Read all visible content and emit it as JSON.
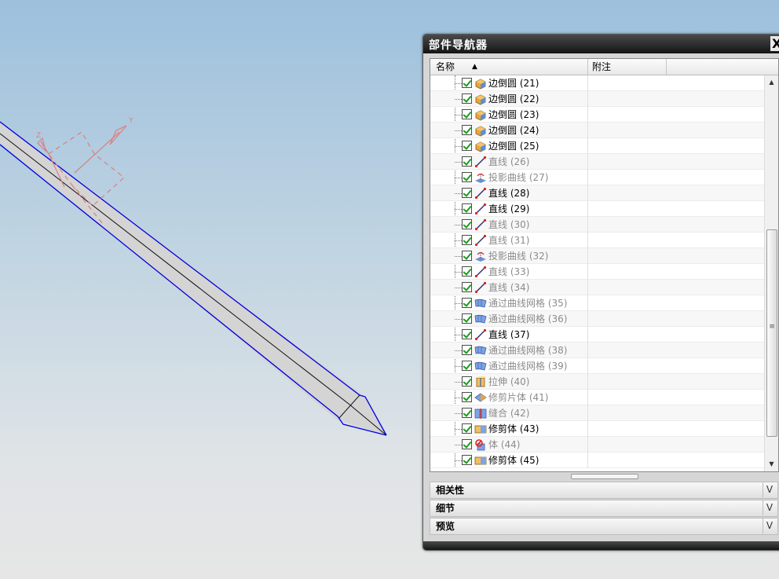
{
  "navigator": {
    "title": "部件导航器",
    "close": "X",
    "columns": {
      "name": "名称",
      "sort_indicator": "▲",
      "note": "附注"
    },
    "rows": [
      {
        "label": "边倒圆 (21)",
        "icon": "edge-blend-icon",
        "dim": false
      },
      {
        "label": "边倒圆 (22)",
        "icon": "edge-blend-icon",
        "dim": false
      },
      {
        "label": "边倒圆 (23)",
        "icon": "edge-blend-icon",
        "dim": false
      },
      {
        "label": "边倒圆 (24)",
        "icon": "edge-blend-icon",
        "dim": false
      },
      {
        "label": "边倒圆 (25)",
        "icon": "edge-blend-icon",
        "dim": false
      },
      {
        "label": "直线 (26)",
        "icon": "line-icon",
        "dim": true
      },
      {
        "label": "投影曲线 (27)",
        "icon": "project-curve-icon",
        "dim": true
      },
      {
        "label": "直线 (28)",
        "icon": "line-icon",
        "dim": false
      },
      {
        "label": "直线 (29)",
        "icon": "line-icon",
        "dim": false
      },
      {
        "label": "直线 (30)",
        "icon": "line-icon",
        "dim": true
      },
      {
        "label": "直线 (31)",
        "icon": "line-icon",
        "dim": true
      },
      {
        "label": "投影曲线 (32)",
        "icon": "project-curve-icon",
        "dim": true
      },
      {
        "label": "直线 (33)",
        "icon": "line-icon",
        "dim": true
      },
      {
        "label": "直线 (34)",
        "icon": "line-icon",
        "dim": true
      },
      {
        "label": "通过曲线网格 (35)",
        "icon": "curve-mesh-icon",
        "dim": true
      },
      {
        "label": "通过曲线网格 (36)",
        "icon": "curve-mesh-icon",
        "dim": true
      },
      {
        "label": "直线 (37)",
        "icon": "line-icon",
        "dim": false
      },
      {
        "label": "通过曲线网格 (38)",
        "icon": "curve-mesh-icon",
        "dim": true
      },
      {
        "label": "通过曲线网格 (39)",
        "icon": "curve-mesh-icon",
        "dim": true
      },
      {
        "label": "拉伸 (40)",
        "icon": "extrude-icon",
        "dim": true
      },
      {
        "label": "修剪片体 (41)",
        "icon": "trim-sheet-icon",
        "dim": true
      },
      {
        "label": "缝合 (42)",
        "icon": "sew-icon",
        "dim": true
      },
      {
        "label": "修剪体 (43)",
        "icon": "trim-body-icon",
        "dim": false
      },
      {
        "label": "体 (44)",
        "icon": "body-icon",
        "dim": true
      },
      {
        "label": "修剪体 (45)",
        "icon": "trim-body-icon",
        "dim": false
      }
    ],
    "panels": [
      {
        "label": "相关性",
        "chevron": "V"
      },
      {
        "label": "细节",
        "chevron": "V"
      },
      {
        "label": "预览",
        "chevron": "V"
      }
    ],
    "scroll": {
      "up": "▲",
      "down": "▼",
      "grip": "≡"
    }
  },
  "viewport": {
    "csys_labels": {
      "x_axis": "X",
      "y_axis": "Y",
      "z_axis": "Z"
    },
    "colors": {
      "edge": "#0000e0",
      "body": "#d3d3d3",
      "csys": "#d98080"
    }
  }
}
